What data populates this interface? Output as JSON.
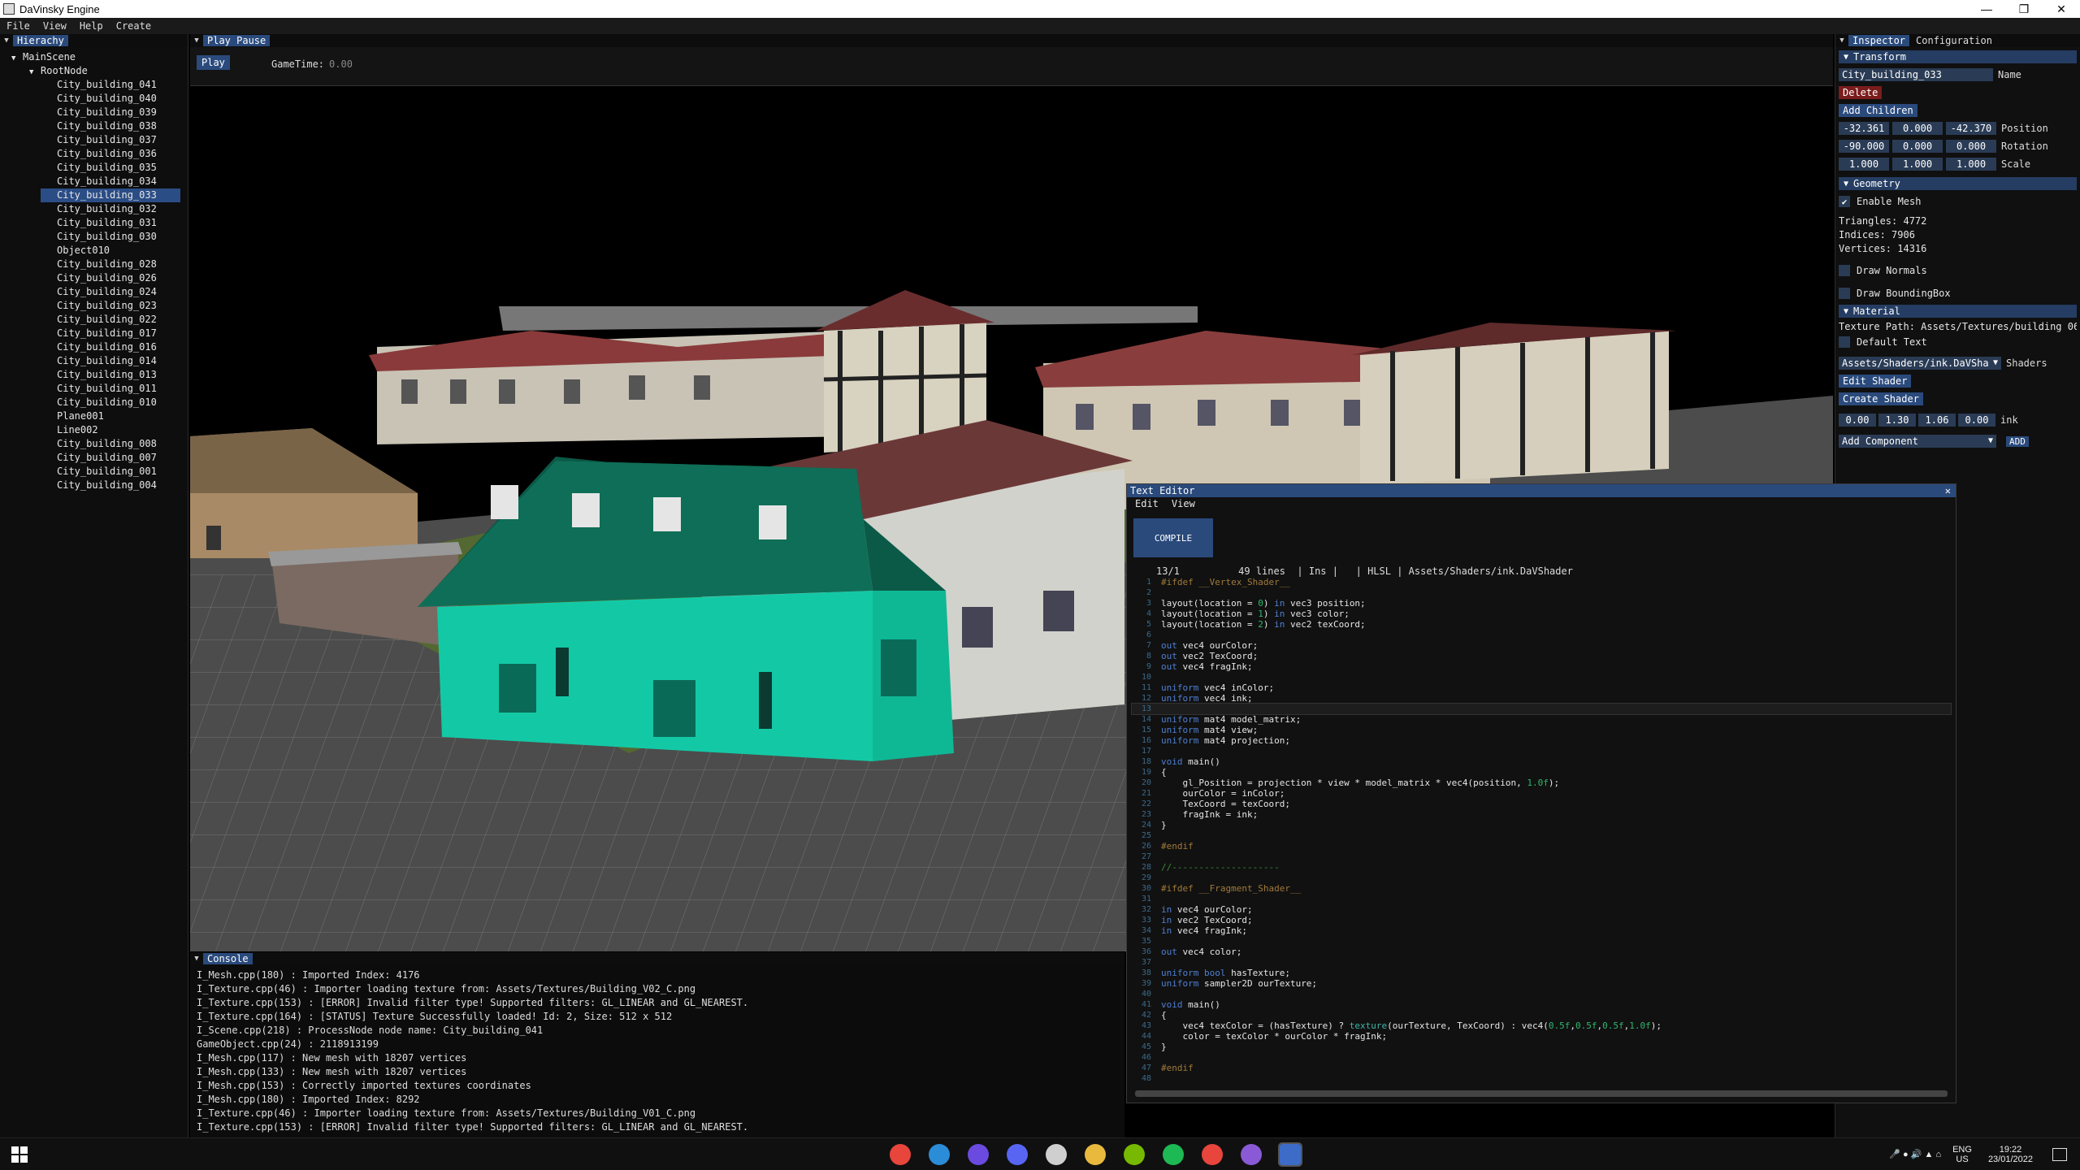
{
  "window": {
    "title": "DaVinsky Engine",
    "min_glyph": "—",
    "max_glyph": "❐",
    "close_glyph": "✕"
  },
  "menu": [
    "File",
    "View",
    "Help",
    "Create"
  ],
  "hierarchy": {
    "tab": "Hierachy",
    "root": "MainScene",
    "root_node": "RootNode",
    "items": [
      "City_building_041",
      "City_building_040",
      "City_building_039",
      "City_building_038",
      "City_building_037",
      "City_building_036",
      "City_building_035",
      "City_building_034",
      "City_building_033",
      "City_building_032",
      "City_building_031",
      "City_building_030",
      "Object010",
      "City_building_028",
      "City_building_026",
      "City_building_024",
      "City_building_023",
      "City_building_022",
      "City_building_017",
      "City_building_016",
      "City_building_014",
      "City_building_013",
      "City_building_011",
      "City_building_010",
      "Plane001",
      "Line002",
      "City_building_008",
      "City_building_007",
      "City_building_001",
      "City_building_004"
    ],
    "selected_index": 8
  },
  "scene": {
    "tab": "Play Pause",
    "play_label": "Play",
    "gametime_label": "GameTime:",
    "gametime_value": "0.00"
  },
  "inspector": {
    "tab_active": "Inspector",
    "tab_other": "Configuration",
    "transform": {
      "title": "Transform",
      "name_value": "City_building_033",
      "name_label": "Name",
      "delete_label": "Delete",
      "add_children_label": "Add Children",
      "position": [
        "-32.361",
        "0.000",
        "-42.370"
      ],
      "position_label": "Position",
      "rotation": [
        "-90.000",
        "0.000",
        "0.000"
      ],
      "rotation_label": "Rotation",
      "scale": [
        "1.000",
        "1.000",
        "1.000"
      ],
      "scale_label": "Scale"
    },
    "geometry": {
      "title": "Geometry",
      "enable_mesh": "Enable Mesh",
      "triangles": "Triangles: 4772",
      "indices": "Indices: 7906",
      "vertices": "Vertices: 14316",
      "draw_normals": "Draw Normals",
      "draw_bbox": "Draw BoundingBox"
    },
    "material": {
      "title": "Material",
      "texture_path": "Texture Path: Assets/Textures/building 06",
      "default_text": "Default Text",
      "shader_value": "Assets/Shaders/ink.DaVSha",
      "shaders_label": "Shaders",
      "edit_shader": "Edit Shader",
      "create_shader": "Create Shader",
      "ink": [
        "0.00",
        "1.30",
        "1.06",
        "0.00"
      ],
      "ink_label": "ink"
    },
    "add_component": "Add Component",
    "add_label": "ADD"
  },
  "editor": {
    "title": "Text Editor",
    "close_glyph": "✕",
    "menu": [
      "Edit",
      "View"
    ],
    "compile_label": "COMPILE",
    "status": "13/1          49 lines  | Ins |   | HLSL | Assets/Shaders/ink.DaVShader",
    "current_line": 13
  },
  "console": {
    "tab": "Console",
    "lines": [
      "I_Mesh.cpp(180) : Imported Index: 4176",
      "I_Texture.cpp(46) : Importer loading texture from: Assets/Textures/Building_V02_C.png",
      "I_Texture.cpp(153) : [ERROR] Invalid filter type! Supported filters: GL_LINEAR and GL_NEAREST.",
      "I_Texture.cpp(164) : [STATUS] Texture Successfully loaded! Id: 2, Size: 512 x 512",
      "I_Scene.cpp(218) : ProcessNode node name: City_building_041",
      "GameObject.cpp(24) : 2118913199",
      "I_Mesh.cpp(117) : New mesh with 18207 vertices",
      "I_Mesh.cpp(133) : New mesh with 18207 vertices",
      "I_Mesh.cpp(153) : Correctly imported textures coordinates",
      "I_Mesh.cpp(180) : Imported Index: 8292",
      "I_Texture.cpp(46) : Importer loading texture from: Assets/Textures/Building_V01_C.png",
      "I_Texture.cpp(153) : [ERROR] Invalid filter type! Supported filters: GL_LINEAR and GL_NEAREST."
    ]
  },
  "taskbar": {
    "icons": [
      "chrome-icon",
      "vscode-icon",
      "github-icon",
      "discord-icon",
      "settings-icon",
      "explorer-icon",
      "nvidia-icon",
      "spotify-icon",
      "chrome-icon-2",
      "visualstudio-icon",
      "engine-icon"
    ],
    "lang": "ENG",
    "region": "US",
    "time": "19:22",
    "date": "23/01/2022"
  }
}
